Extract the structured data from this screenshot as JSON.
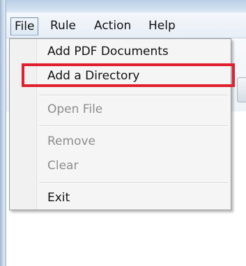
{
  "menubar": {
    "items": [
      {
        "label": "File",
        "active": true
      },
      {
        "label": "Rule",
        "active": false
      },
      {
        "label": "Action",
        "active": false
      },
      {
        "label": "Help",
        "active": false
      }
    ]
  },
  "file_menu": {
    "items": [
      {
        "label": "Add PDF Documents",
        "enabled": true
      },
      {
        "label": "Add a Directory",
        "enabled": true,
        "annotated": true
      },
      {
        "label": "Open File",
        "enabled": false
      },
      {
        "label": "Remove",
        "enabled": false
      },
      {
        "label": "Clear",
        "enabled": false
      },
      {
        "label": "Exit",
        "enabled": true
      }
    ]
  },
  "colors": {
    "annotation_box": "#e0202e",
    "disabled_text": "#8d8d8d",
    "menu_background": "#f5f5f5"
  }
}
